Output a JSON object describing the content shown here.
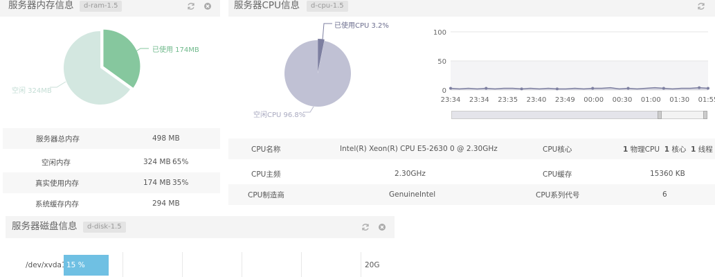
{
  "ram": {
    "title": "服务器内存信息",
    "badge": "d-ram-1.5",
    "chart_data": {
      "type": "pie",
      "slices": [
        {
          "label": "已使用 174MB",
          "value": 174,
          "color": "#86c79e"
        },
        {
          "label": "空闲 324MB",
          "value": 324,
          "color": "#d3e7e0"
        }
      ]
    },
    "rows": [
      {
        "label": "服务器总内存",
        "value": "498 MB",
        "pct": ""
      },
      {
        "label": "空闲内存",
        "value": "324 MB",
        "pct": "65%"
      },
      {
        "label": "真实使用内存",
        "value": "174 MB",
        "pct": "35%"
      },
      {
        "label": "系统缓存内存",
        "value": "294 MB",
        "pct": ""
      }
    ]
  },
  "cpu": {
    "title": "服务器CPU信息",
    "badge": "d-cpu-1.5",
    "pie_chart": {
      "type": "pie",
      "slices": [
        {
          "label": "已使用CPU 3.2%",
          "value": 3.2,
          "color": "#7d7fa0"
        },
        {
          "label": "空闲CPU 96.8%",
          "value": 96.8,
          "color": "#c0c1d4"
        }
      ]
    },
    "line_chart": {
      "type": "line",
      "ylim": [
        0,
        100
      ],
      "yticks": [
        0,
        50,
        100
      ],
      "x": [
        "23:34",
        "23:34",
        "23:35",
        "23:40",
        "23:49",
        "00:00",
        "00:30",
        "01:00",
        "01:30",
        "01:55"
      ],
      "values": [
        3,
        2,
        3,
        2,
        3,
        2,
        3,
        3,
        2,
        3,
        2,
        3,
        2,
        2,
        3,
        2,
        3,
        3,
        4,
        2,
        3,
        2,
        3,
        4,
        3,
        2,
        3,
        3,
        4,
        3
      ]
    },
    "rows": [
      {
        "l1": "CPU名称",
        "v1": "Intel(R) Xeon(R) CPU E5-2630 0 @ 2.30GHz",
        "l2": "CPU核心",
        "v2": [
          "1",
          "物理CPU",
          "1",
          "核心",
          "1",
          "线程"
        ]
      },
      {
        "l1": "CPU主频",
        "v1": "2.30GHz",
        "l2": "CPU缓存",
        "v2": "15360 KB"
      },
      {
        "l1": "CPU制造商",
        "v1": "GenuineIntel",
        "l2": "CPU系列代号",
        "v2": "6"
      }
    ]
  },
  "disk": {
    "title": "服务器磁盘信息",
    "badge": "d-disk-1.5",
    "rows": [
      {
        "device": "/dev/xvda1",
        "usage_label": "15 %",
        "usage": 0.15,
        "size": "20G",
        "bar_color": "#6fc0e3"
      }
    ]
  }
}
